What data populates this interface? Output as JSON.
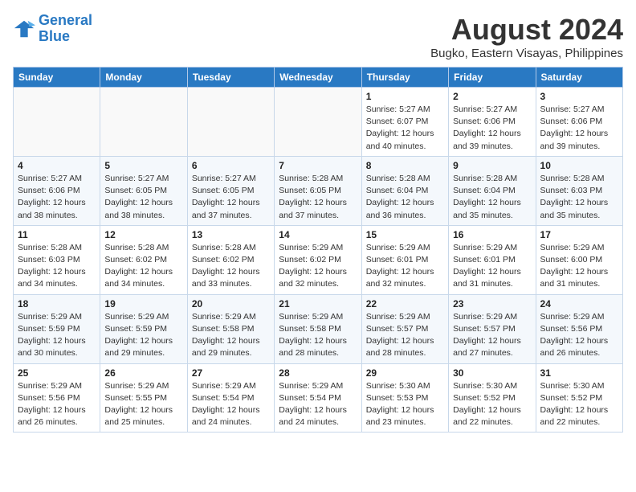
{
  "logo": {
    "line1": "General",
    "line2": "Blue"
  },
  "title": "August 2024",
  "subtitle": "Bugko, Eastern Visayas, Philippines",
  "days_of_week": [
    "Sunday",
    "Monday",
    "Tuesday",
    "Wednesday",
    "Thursday",
    "Friday",
    "Saturday"
  ],
  "weeks": [
    [
      {
        "day": "",
        "info": ""
      },
      {
        "day": "",
        "info": ""
      },
      {
        "day": "",
        "info": ""
      },
      {
        "day": "",
        "info": ""
      },
      {
        "day": "1",
        "info": "Sunrise: 5:27 AM\nSunset: 6:07 PM\nDaylight: 12 hours\nand 40 minutes."
      },
      {
        "day": "2",
        "info": "Sunrise: 5:27 AM\nSunset: 6:06 PM\nDaylight: 12 hours\nand 39 minutes."
      },
      {
        "day": "3",
        "info": "Sunrise: 5:27 AM\nSunset: 6:06 PM\nDaylight: 12 hours\nand 39 minutes."
      }
    ],
    [
      {
        "day": "4",
        "info": "Sunrise: 5:27 AM\nSunset: 6:06 PM\nDaylight: 12 hours\nand 38 minutes."
      },
      {
        "day": "5",
        "info": "Sunrise: 5:27 AM\nSunset: 6:05 PM\nDaylight: 12 hours\nand 38 minutes."
      },
      {
        "day": "6",
        "info": "Sunrise: 5:27 AM\nSunset: 6:05 PM\nDaylight: 12 hours\nand 37 minutes."
      },
      {
        "day": "7",
        "info": "Sunrise: 5:28 AM\nSunset: 6:05 PM\nDaylight: 12 hours\nand 37 minutes."
      },
      {
        "day": "8",
        "info": "Sunrise: 5:28 AM\nSunset: 6:04 PM\nDaylight: 12 hours\nand 36 minutes."
      },
      {
        "day": "9",
        "info": "Sunrise: 5:28 AM\nSunset: 6:04 PM\nDaylight: 12 hours\nand 35 minutes."
      },
      {
        "day": "10",
        "info": "Sunrise: 5:28 AM\nSunset: 6:03 PM\nDaylight: 12 hours\nand 35 minutes."
      }
    ],
    [
      {
        "day": "11",
        "info": "Sunrise: 5:28 AM\nSunset: 6:03 PM\nDaylight: 12 hours\nand 34 minutes."
      },
      {
        "day": "12",
        "info": "Sunrise: 5:28 AM\nSunset: 6:02 PM\nDaylight: 12 hours\nand 34 minutes."
      },
      {
        "day": "13",
        "info": "Sunrise: 5:28 AM\nSunset: 6:02 PM\nDaylight: 12 hours\nand 33 minutes."
      },
      {
        "day": "14",
        "info": "Sunrise: 5:29 AM\nSunset: 6:02 PM\nDaylight: 12 hours\nand 32 minutes."
      },
      {
        "day": "15",
        "info": "Sunrise: 5:29 AM\nSunset: 6:01 PM\nDaylight: 12 hours\nand 32 minutes."
      },
      {
        "day": "16",
        "info": "Sunrise: 5:29 AM\nSunset: 6:01 PM\nDaylight: 12 hours\nand 31 minutes."
      },
      {
        "day": "17",
        "info": "Sunrise: 5:29 AM\nSunset: 6:00 PM\nDaylight: 12 hours\nand 31 minutes."
      }
    ],
    [
      {
        "day": "18",
        "info": "Sunrise: 5:29 AM\nSunset: 5:59 PM\nDaylight: 12 hours\nand 30 minutes."
      },
      {
        "day": "19",
        "info": "Sunrise: 5:29 AM\nSunset: 5:59 PM\nDaylight: 12 hours\nand 29 minutes."
      },
      {
        "day": "20",
        "info": "Sunrise: 5:29 AM\nSunset: 5:58 PM\nDaylight: 12 hours\nand 29 minutes."
      },
      {
        "day": "21",
        "info": "Sunrise: 5:29 AM\nSunset: 5:58 PM\nDaylight: 12 hours\nand 28 minutes."
      },
      {
        "day": "22",
        "info": "Sunrise: 5:29 AM\nSunset: 5:57 PM\nDaylight: 12 hours\nand 28 minutes."
      },
      {
        "day": "23",
        "info": "Sunrise: 5:29 AM\nSunset: 5:57 PM\nDaylight: 12 hours\nand 27 minutes."
      },
      {
        "day": "24",
        "info": "Sunrise: 5:29 AM\nSunset: 5:56 PM\nDaylight: 12 hours\nand 26 minutes."
      }
    ],
    [
      {
        "day": "25",
        "info": "Sunrise: 5:29 AM\nSunset: 5:56 PM\nDaylight: 12 hours\nand 26 minutes."
      },
      {
        "day": "26",
        "info": "Sunrise: 5:29 AM\nSunset: 5:55 PM\nDaylight: 12 hours\nand 25 minutes."
      },
      {
        "day": "27",
        "info": "Sunrise: 5:29 AM\nSunset: 5:54 PM\nDaylight: 12 hours\nand 24 minutes."
      },
      {
        "day": "28",
        "info": "Sunrise: 5:29 AM\nSunset: 5:54 PM\nDaylight: 12 hours\nand 24 minutes."
      },
      {
        "day": "29",
        "info": "Sunrise: 5:30 AM\nSunset: 5:53 PM\nDaylight: 12 hours\nand 23 minutes."
      },
      {
        "day": "30",
        "info": "Sunrise: 5:30 AM\nSunset: 5:52 PM\nDaylight: 12 hours\nand 22 minutes."
      },
      {
        "day": "31",
        "info": "Sunrise: 5:30 AM\nSunset: 5:52 PM\nDaylight: 12 hours\nand 22 minutes."
      }
    ]
  ]
}
